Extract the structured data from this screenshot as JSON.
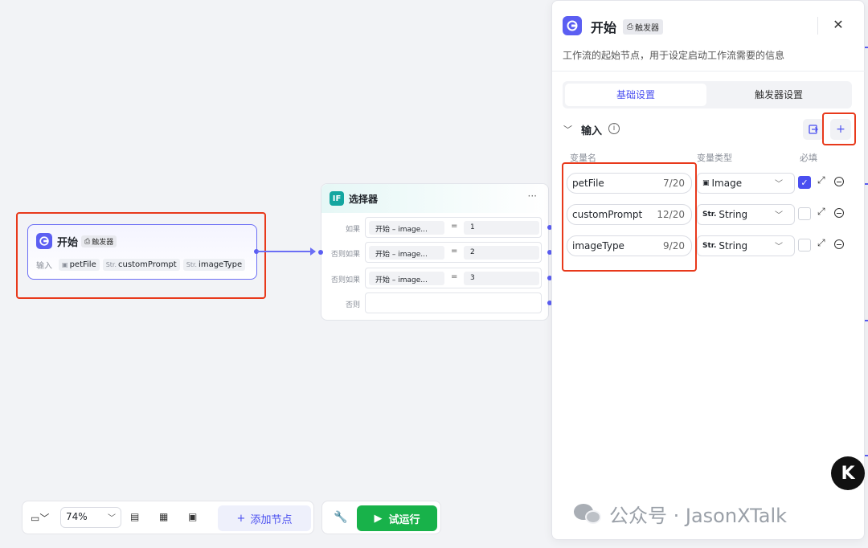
{
  "start_node": {
    "title": "开始",
    "badge": "触发器",
    "input_label": "输入",
    "inputs": [
      {
        "type": "",
        "name": "petFile",
        "icon": "image-icon"
      },
      {
        "type": "Str.",
        "name": "customPrompt"
      },
      {
        "type": "Str.",
        "name": "imageType"
      }
    ]
  },
  "selector_node": {
    "logo": "IF",
    "title": "选择器",
    "more": "···",
    "conditions": [
      {
        "label": "如果",
        "var": "开始 – image...",
        "op": "=",
        "value": "1"
      },
      {
        "label": "否则如果",
        "var": "开始 – image...",
        "op": "=",
        "value": "2"
      },
      {
        "label": "否则如果",
        "var": "开始 – image...",
        "op": "=",
        "value": "3"
      },
      {
        "label": "否则",
        "var": "",
        "op": "",
        "value": ""
      }
    ]
  },
  "panel": {
    "title": "开始",
    "badge": "触发器",
    "close": "✕",
    "description": "工作流的起始节点，用于设定启动工作流需要的信息",
    "tabs": [
      {
        "label": "基础设置",
        "active": true
      },
      {
        "label": "触发器设置",
        "active": false
      }
    ],
    "section_title": "输入",
    "info": "i",
    "add": "+",
    "columns": {
      "name": "变量名",
      "type": "变量类型",
      "required": "必填"
    },
    "variables": [
      {
        "name": "petFile",
        "count": "7/20",
        "type_icon": "",
        "type": "Image",
        "required": true
      },
      {
        "name": "customPrompt",
        "count": "12/20",
        "type_icon": "Str.",
        "type": "String",
        "required": false
      },
      {
        "name": "imageType",
        "count": "9/20",
        "type_icon": "Str.",
        "type": "String",
        "required": false
      }
    ]
  },
  "toolbar": {
    "zoom": "74%",
    "add_node": "添加节点",
    "add_icon": "+",
    "run": "试运行"
  },
  "watermark": "公众号 · JasonXTalk",
  "colors": {
    "accent": "#4a4ff0",
    "highlight": "#e8391b",
    "run": "#18b24a",
    "selector": "#14a6a0"
  }
}
